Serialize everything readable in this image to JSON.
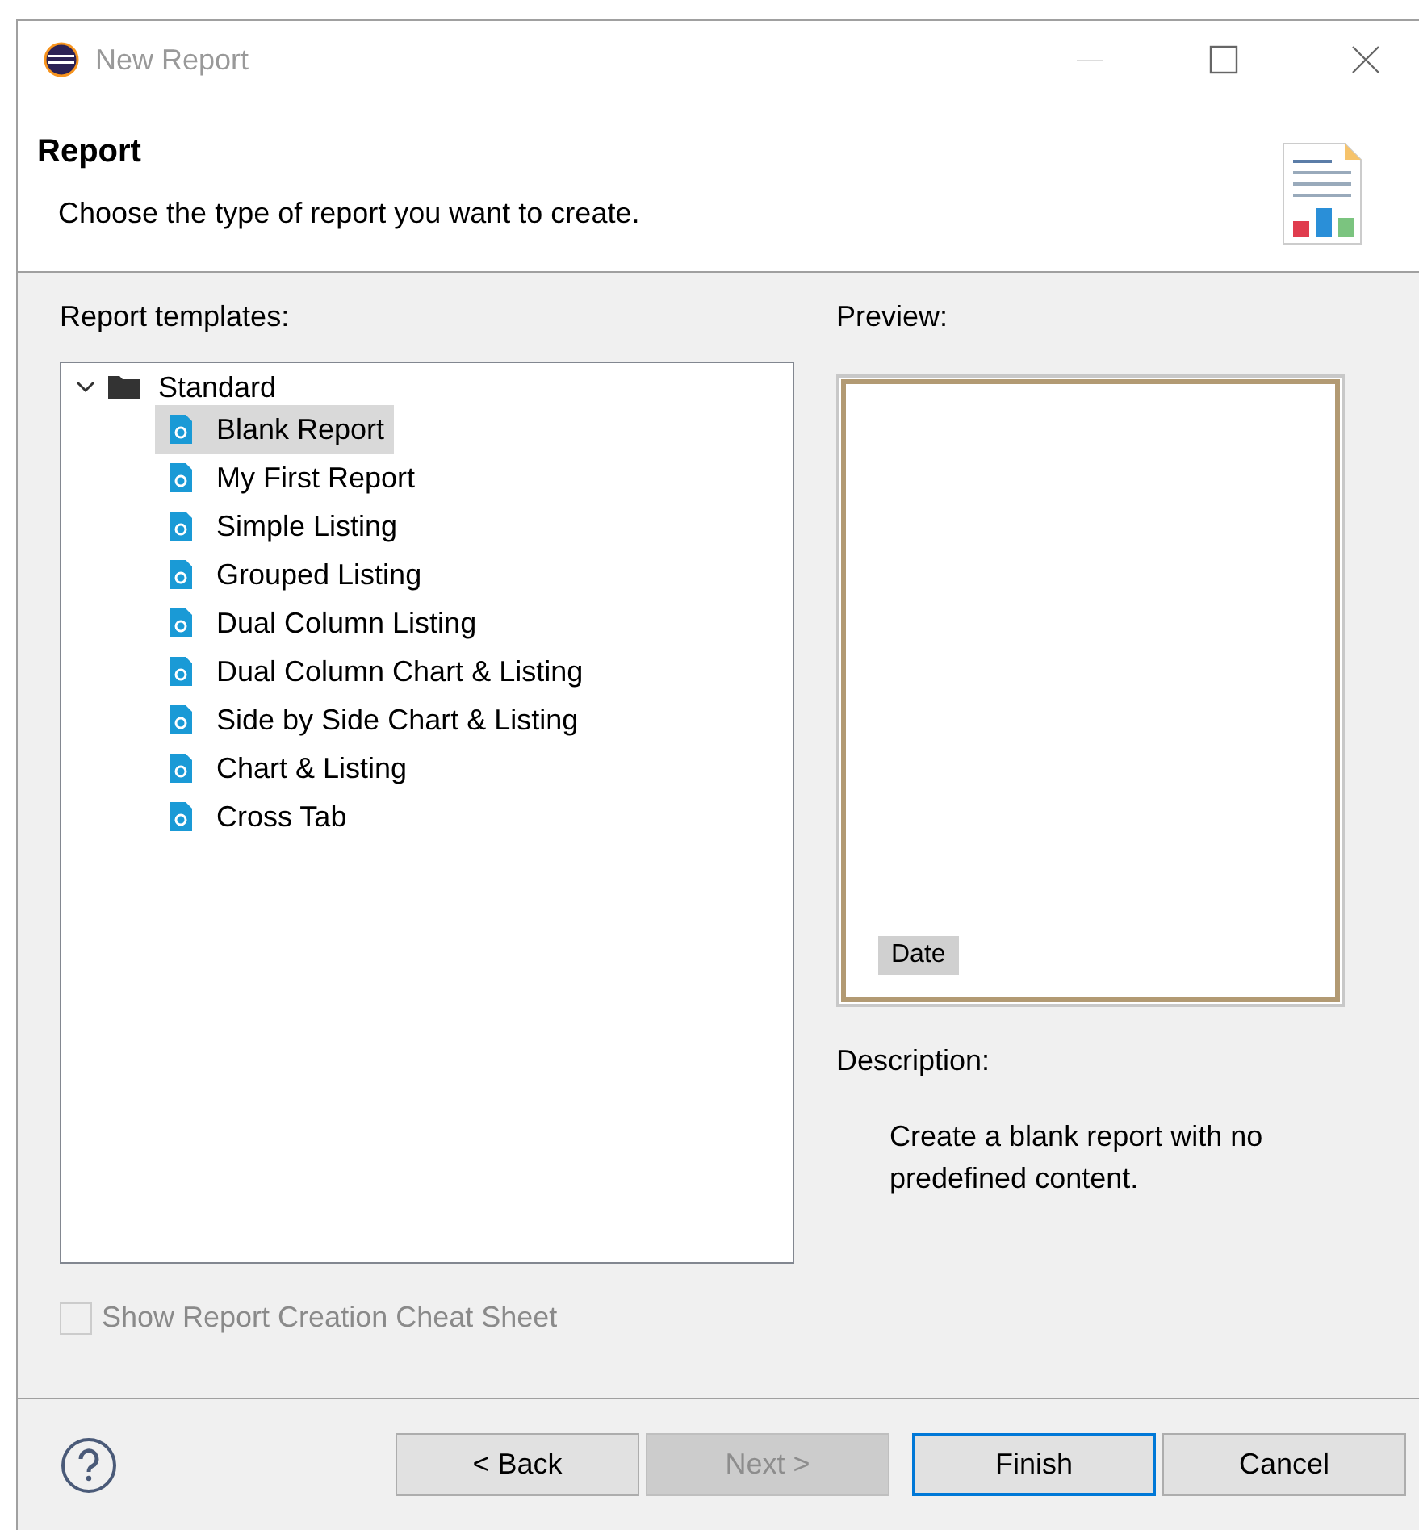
{
  "window": {
    "title": "New Report"
  },
  "header": {
    "title": "Report",
    "subtitle": "Choose the type of report you want to create."
  },
  "templates": {
    "label": "Report templates:",
    "tree": [
      {
        "label": "Standard",
        "expanded": true,
        "children": [
          {
            "label": "Blank Report",
            "selected": true
          },
          {
            "label": "My First Report",
            "selected": false
          },
          {
            "label": "Simple Listing",
            "selected": false
          },
          {
            "label": "Grouped Listing",
            "selected": false
          },
          {
            "label": "Dual Column Listing",
            "selected": false
          },
          {
            "label": "Dual Column Chart & Listing",
            "selected": false
          },
          {
            "label": "Side by Side Chart & Listing",
            "selected": false
          },
          {
            "label": "Chart & Listing",
            "selected": false
          },
          {
            "label": "Cross Tab",
            "selected": false
          }
        ]
      }
    ]
  },
  "preview": {
    "label": "Preview:",
    "field": "Date"
  },
  "description": {
    "label": "Description:",
    "text": "Create a blank report with no predefined content."
  },
  "cheat_sheet": {
    "label": "Show Report Creation Cheat Sheet",
    "checked": false,
    "disabled": true
  },
  "buttons": [
    {
      "label": "< Back",
      "disabled": false,
      "default": false
    },
    {
      "label": "Next >",
      "disabled": true,
      "default": false
    },
    {
      "label": "Finish",
      "disabled": false,
      "default": true
    },
    {
      "label": "Cancel",
      "disabled": false,
      "default": false
    }
  ]
}
